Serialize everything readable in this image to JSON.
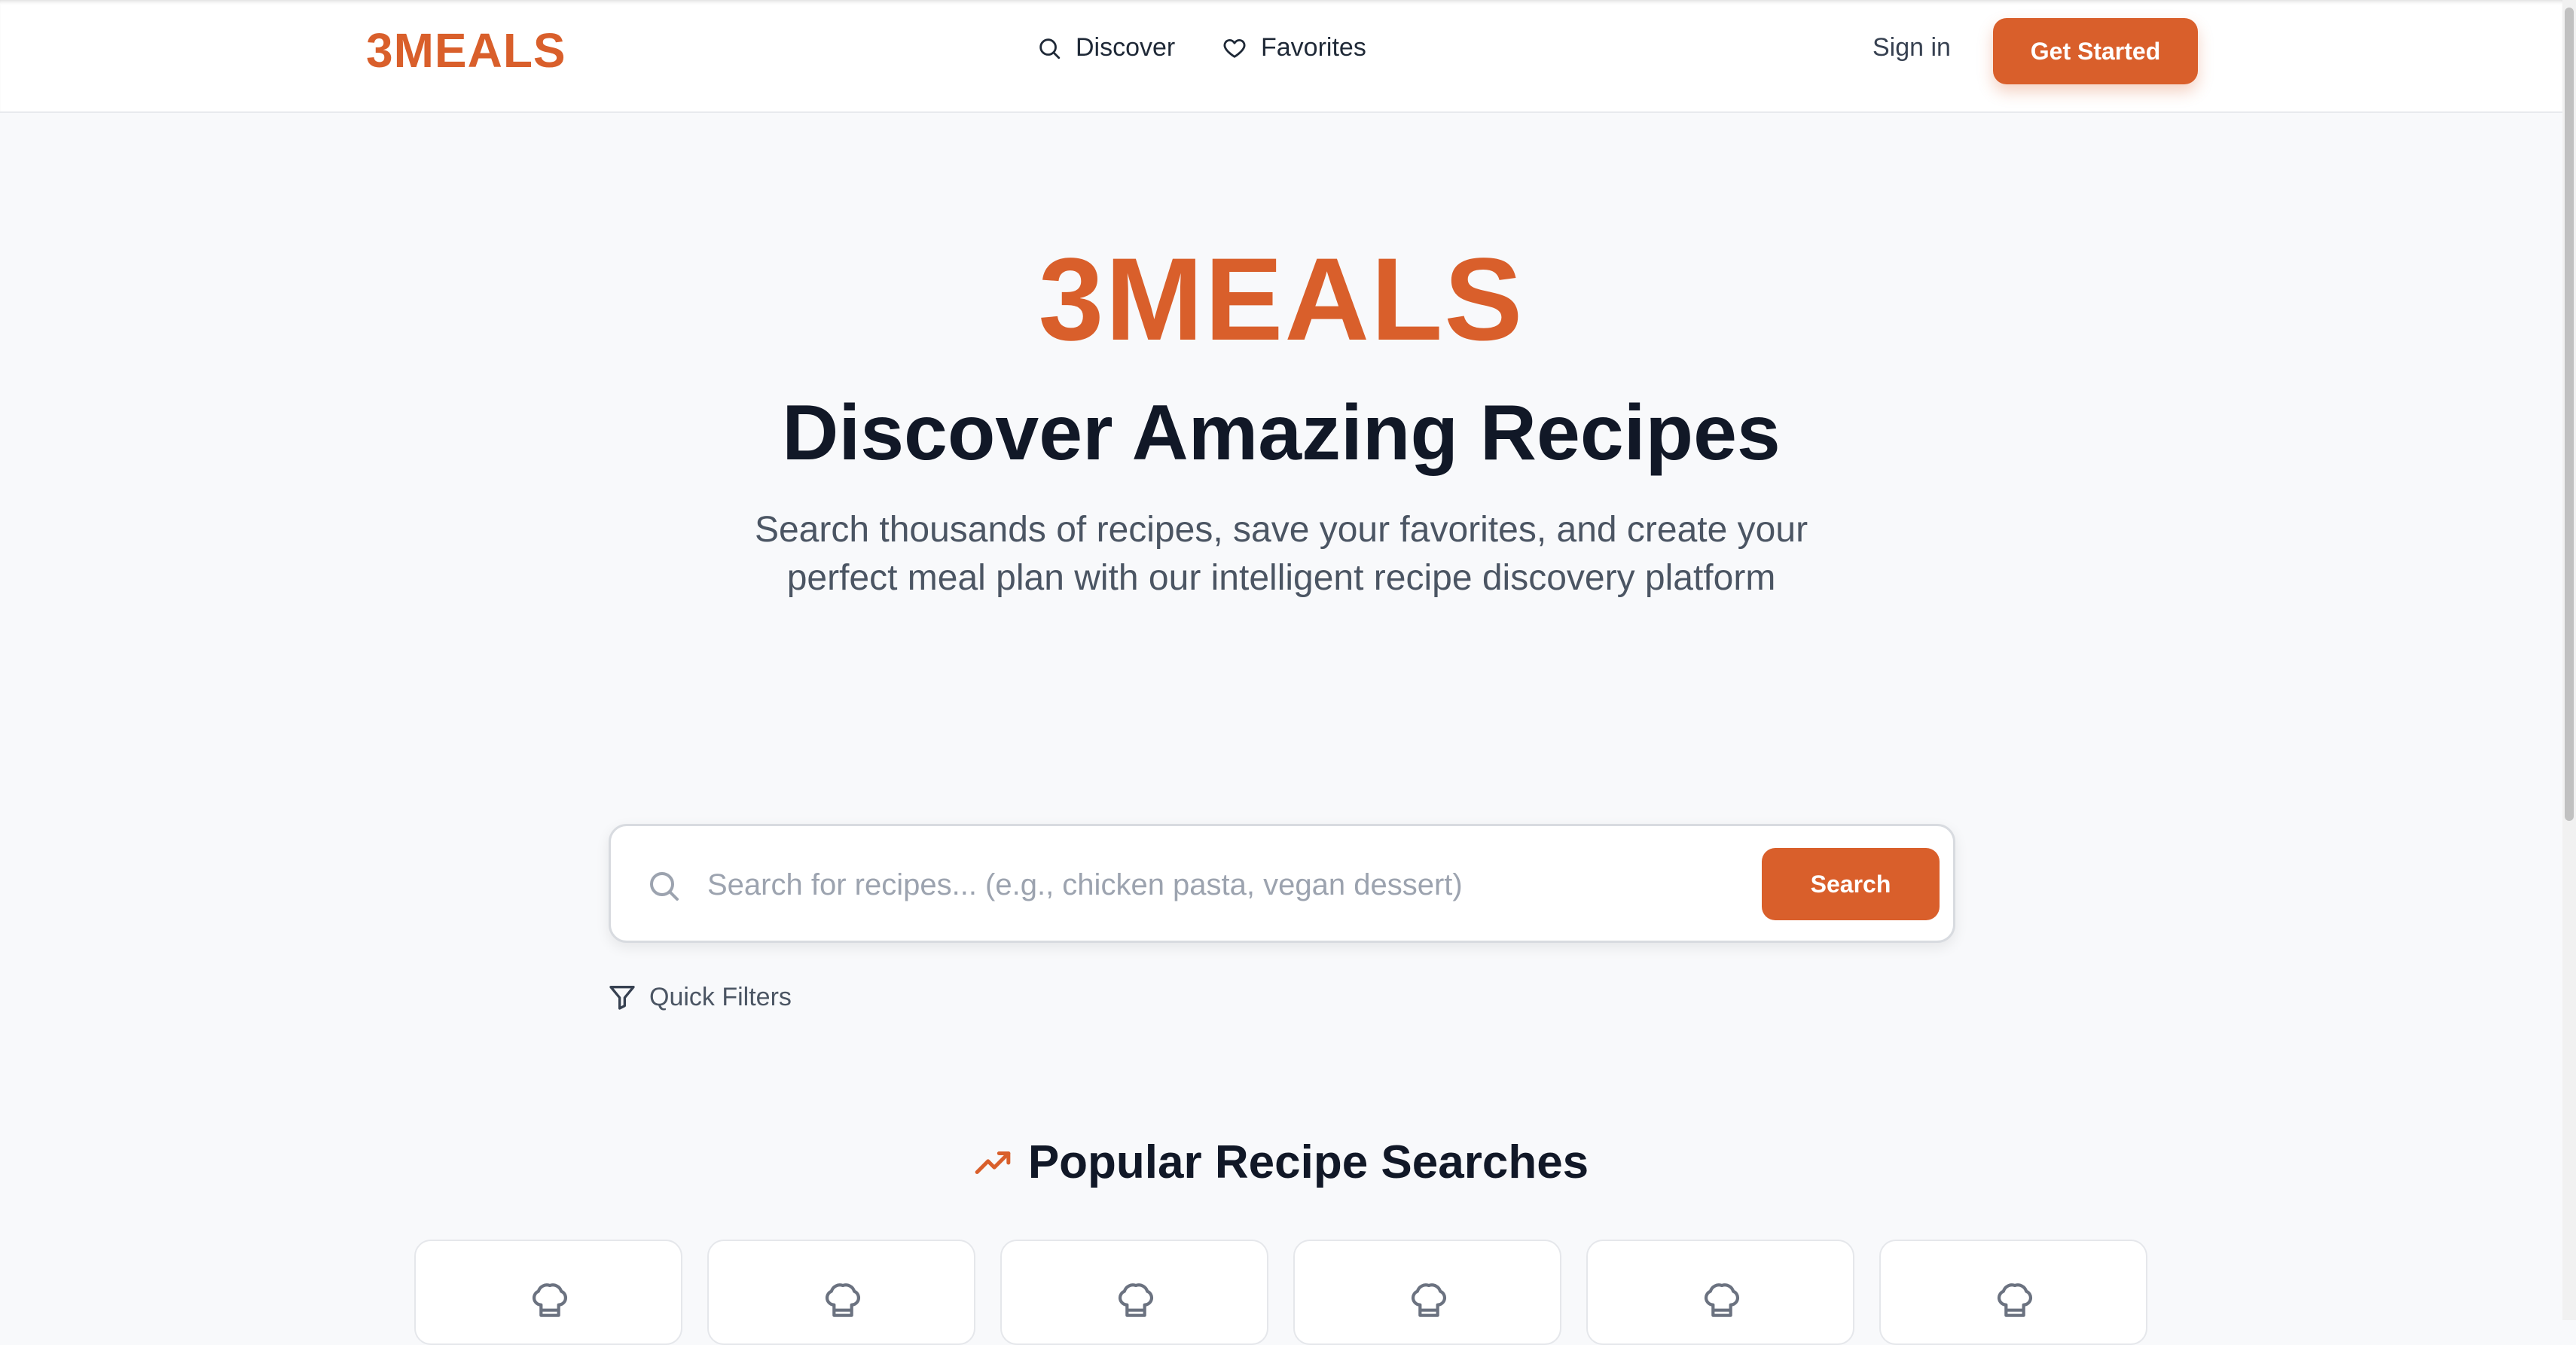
{
  "header": {
    "brand": "3MEALS",
    "nav": [
      {
        "label": "Discover",
        "icon": "search-icon"
      },
      {
        "label": "Favorites",
        "icon": "heart-icon"
      }
    ],
    "sign_in": "Sign in",
    "cta": "Get Started"
  },
  "hero": {
    "brand": "3MEALS",
    "title": "Discover Amazing Recipes",
    "subtitle": "Search thousands of recipes, save your favorites, and create your perfect meal plan with our intelligent recipe discovery platform"
  },
  "search": {
    "placeholder": "Search for recipes... (e.g., chicken pasta, vegan dessert)",
    "value": "",
    "button": "Search",
    "filters_label": "Quick Filters"
  },
  "popular": {
    "title": "Popular Recipe Searches",
    "icon": "trending-up-icon",
    "cards": [
      {
        "icon": "chef-hat-icon"
      },
      {
        "icon": "chef-hat-icon"
      },
      {
        "icon": "chef-hat-icon"
      },
      {
        "icon": "chef-hat-icon"
      },
      {
        "icon": "chef-hat-icon"
      },
      {
        "icon": "chef-hat-icon"
      }
    ]
  },
  "colors": {
    "accent": "#d95f2b",
    "heading": "#111827",
    "body": "#4b5563",
    "background": "#f8f9fb"
  }
}
